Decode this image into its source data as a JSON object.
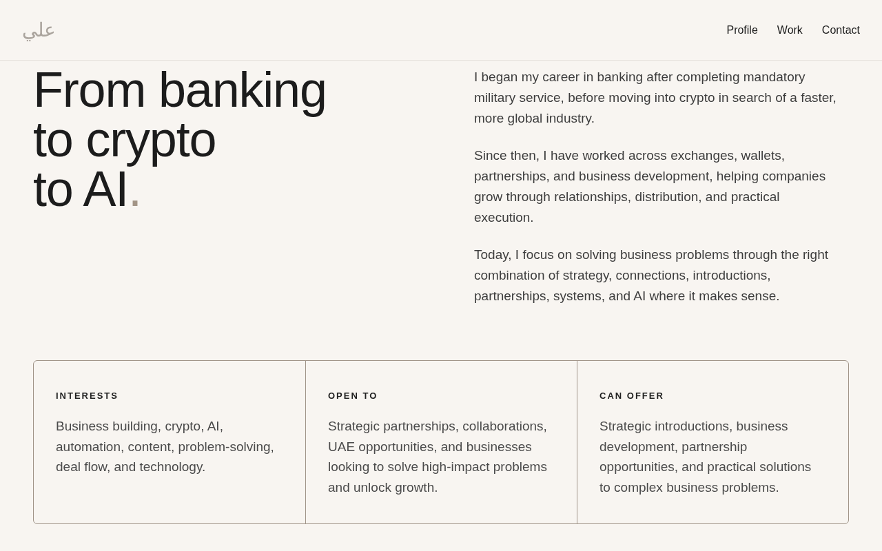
{
  "header": {
    "logo": "علي",
    "nav": [
      {
        "label": "Profile"
      },
      {
        "label": "Work"
      },
      {
        "label": "Contact"
      }
    ]
  },
  "hero": {
    "headline": {
      "lines": [
        "From banking",
        "to crypto",
        "to AI"
      ],
      "accent": "."
    },
    "paragraphs": [
      "I began my career in banking after completing mandatory military service, before moving into crypto in search of a faster, more global industry.",
      "Since then, I have worked across exchanges, wallets, partnerships, and business development, helping companies grow through relationships, distribution, and practical execution.",
      "Today, I focus on solving business problems through the right combination of strategy, connections, introductions, partnerships, systems, and AI where it makes sense."
    ]
  },
  "cards": [
    {
      "title": "INTERESTS",
      "body": "Business building, crypto, AI, automation, content, problem-solving, deal flow, and technology."
    },
    {
      "title": "OPEN TO",
      "body": "Strategic partnerships, collaborations, UAE opportunities, and businesses looking to solve high-impact problems and unlock growth."
    },
    {
      "title": "CAN OFFER",
      "body": "Strategic introductions, business development, partnership opportunities, and practical solutions to complex business problems."
    }
  ]
}
